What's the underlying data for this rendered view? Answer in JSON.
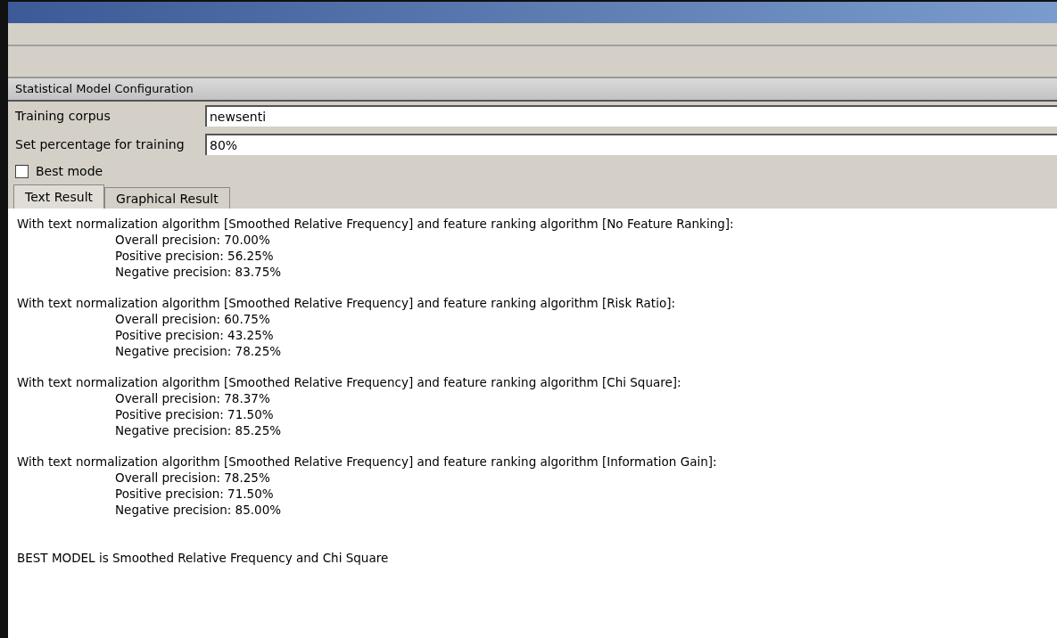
{
  "section": {
    "title": "Statistical Model Configuration"
  },
  "fields": [
    {
      "label": "Training corpus",
      "value": "newsenti"
    },
    {
      "label": "Set percentage for training",
      "value": "80%"
    }
  ],
  "best_mode": {
    "label": "Best mode",
    "checked": false
  },
  "tabs": [
    {
      "label": "Text Result",
      "selected": true
    },
    {
      "label": "Graphical Result",
      "selected": false
    }
  ],
  "results": [
    {
      "header": "With text normalization algorithm [Smoothed Relative Frequency] and feature ranking algorithm [No Feature Ranking]:",
      "lines": [
        "Overall precision: 70.00%",
        "Positive precision: 56.25%",
        "Negative precision: 83.75%"
      ]
    },
    {
      "header": "With text normalization algorithm [Smoothed Relative Frequency] and feature ranking algorithm [Risk Ratio]:",
      "lines": [
        "Overall precision: 60.75%",
        "Positive precision: 43.25%",
        "Negative precision: 78.25%"
      ]
    },
    {
      "header": "With text normalization algorithm [Smoothed Relative Frequency] and feature ranking algorithm [Chi Square]:",
      "lines": [
        "Overall precision: 78.37%",
        "Positive precision: 71.50%",
        "Negative precision: 85.25%"
      ]
    },
    {
      "header": "With text normalization algorithm [Smoothed Relative Frequency] and feature ranking algorithm [Information Gain]:",
      "lines": [
        "Overall precision: 78.25%",
        "Positive precision: 71.50%",
        "Negative precision: 85.00%"
      ]
    }
  ],
  "summary": "BEST MODEL is Smoothed Relative Frequency and Chi Square"
}
